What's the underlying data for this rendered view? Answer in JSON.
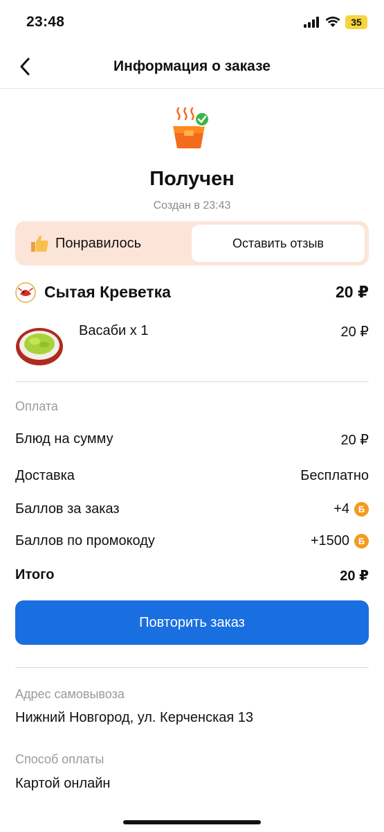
{
  "status_bar": {
    "time": "23:48",
    "battery": "35"
  },
  "nav": {
    "title": "Информация о заказе"
  },
  "order": {
    "status": "Получен",
    "created": "Создан в 23:43"
  },
  "feedback": {
    "liked_label": "Понравилось",
    "review_label": "Оставить отзыв"
  },
  "restaurant": {
    "name": "Сытая Креветка",
    "total": "20 ₽"
  },
  "items": [
    {
      "name": "Васаби x 1",
      "price": "20 ₽"
    }
  ],
  "payment": {
    "section_label": "Оплата",
    "rows": [
      {
        "label": "Блюд на сумму",
        "value": "20 ₽"
      },
      {
        "label": "Доставка",
        "value": "Бесплатно"
      },
      {
        "label": "Баллов за заказ",
        "value": "+4",
        "coin": "Б"
      },
      {
        "label": "Баллов по промокоду",
        "value": "+1500",
        "coin": "Б"
      }
    ],
    "total_label": "Итого",
    "total_value": "20 ₽"
  },
  "repeat_button": "Повторить заказ",
  "pickup": {
    "label": "Адрес самовывоза",
    "value": "Нижний Новгород, ул. Керченская 13"
  },
  "payment_method": {
    "label": "Способ оплаты",
    "value": "Картой онлайн"
  },
  "colors": {
    "accent_blue": "#1a6fe0",
    "feedback_bg": "#fde4d9",
    "coin_orange": "#f59a1e",
    "box_orange": "#f36b1c",
    "check_green": "#3cb64a"
  }
}
